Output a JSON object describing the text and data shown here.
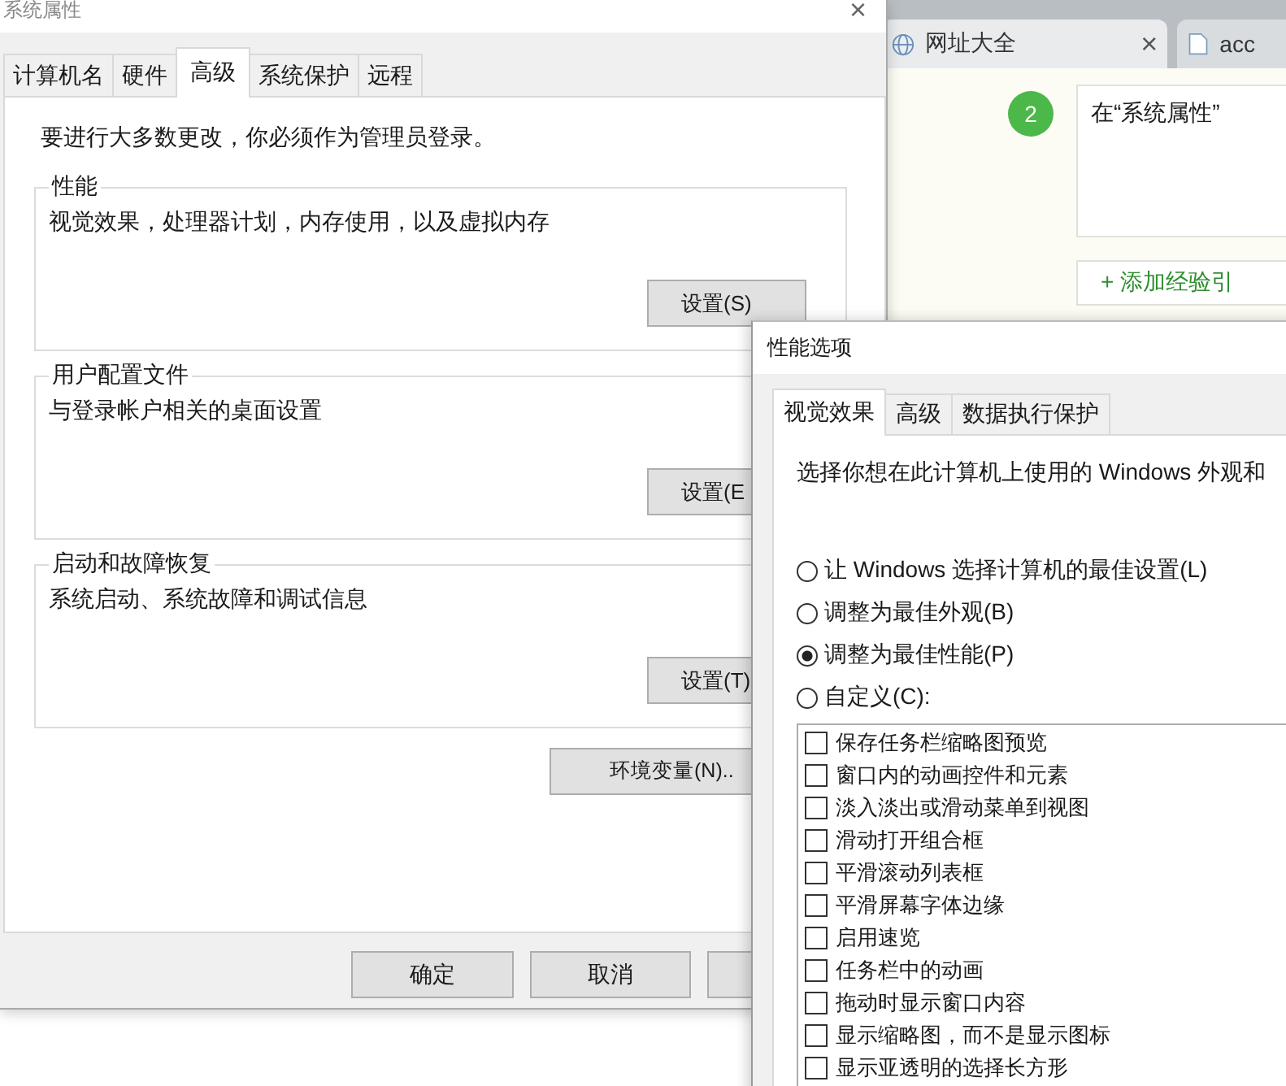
{
  "browser": {
    "tabs": [
      {
        "label": "网址大全",
        "selected": true,
        "close": "×"
      },
      {
        "label": "acc",
        "selected": false
      }
    ],
    "step": {
      "number": "2",
      "text": "在“系统属性”"
    },
    "add_button": "+ 添加经验引"
  },
  "system_properties": {
    "title": "系统属性",
    "close": "×",
    "tabs": [
      {
        "label": "计算机名",
        "selected": false
      },
      {
        "label": "硬件",
        "selected": false
      },
      {
        "label": "高级",
        "selected": true
      },
      {
        "label": "系统保护",
        "selected": false
      },
      {
        "label": "远程",
        "selected": false
      }
    ],
    "notice": "要进行大多数更改，你必须作为管理员登录。",
    "groups": [
      {
        "title": "性能",
        "description": "视觉效果，处理器计划，内存使用，以及虚拟内存",
        "button": "设置(S)"
      },
      {
        "title": "用户配置文件",
        "description": "与登录帐户相关的桌面设置",
        "button": "设置(E"
      },
      {
        "title": "启动和故障恢复",
        "description": "系统启动、系统故障和调试信息",
        "button": "设置(T)"
      }
    ],
    "env_button": "环境变量(N)..",
    "buttons": [
      "确定",
      "取消"
    ]
  },
  "performance_options": {
    "title": "性能选项",
    "tabs": [
      {
        "label": "视觉效果",
        "selected": true
      },
      {
        "label": "高级",
        "selected": false
      },
      {
        "label": "数据执行保护",
        "selected": false
      }
    ],
    "description": "选择你想在此计算机上使用的 Windows 外观和",
    "radios": [
      {
        "label": "让 Windows 选择计算机的最佳设置(L)",
        "selected": false
      },
      {
        "label": "调整为最佳外观(B)",
        "selected": false
      },
      {
        "label": "调整为最佳性能(P)",
        "selected": true
      },
      {
        "label": "自定义(C):",
        "selected": false
      }
    ],
    "effects": [
      {
        "label": "保存任务栏缩略图预览",
        "checked": false
      },
      {
        "label": "窗口内的动画控件和元素",
        "checked": false
      },
      {
        "label": "淡入淡出或滑动菜单到视图",
        "checked": false
      },
      {
        "label": "滑动打开组合框",
        "checked": false
      },
      {
        "label": "平滑滚动列表框",
        "checked": false
      },
      {
        "label": "平滑屏幕字体边缘",
        "checked": false
      },
      {
        "label": "启用速览",
        "checked": false
      },
      {
        "label": "任务栏中的动画",
        "checked": false
      },
      {
        "label": "拖动时显示窗口内容",
        "checked": false
      },
      {
        "label": "显示缩略图，而不是显示图标",
        "checked": false
      },
      {
        "label": "显示亚透明的选择长方形",
        "checked": false
      }
    ]
  }
}
